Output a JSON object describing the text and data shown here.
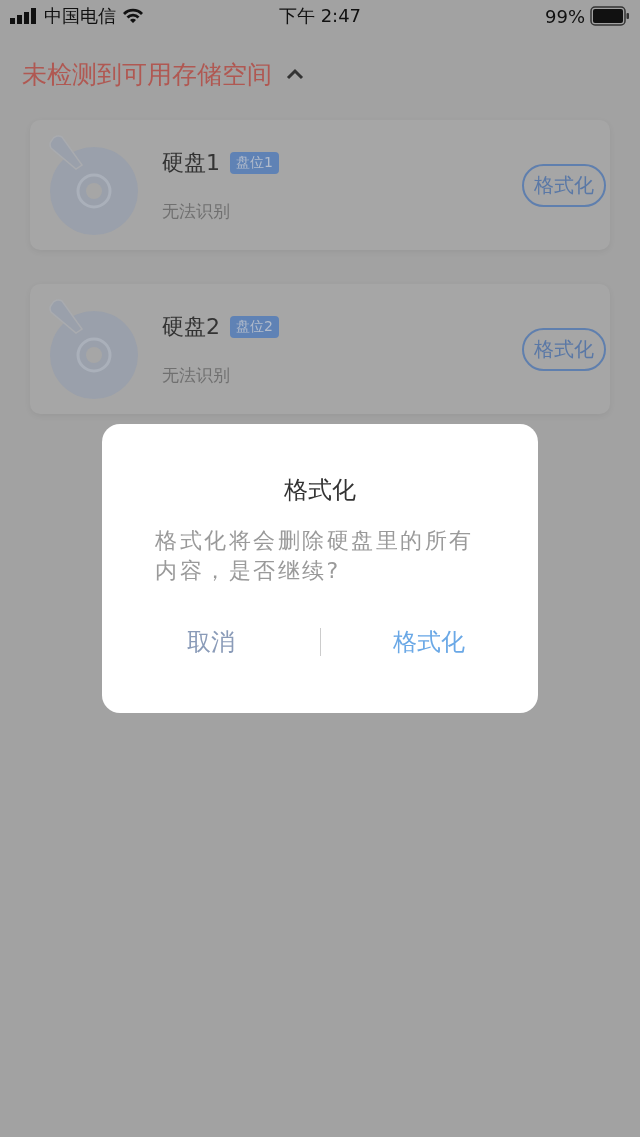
{
  "status_bar": {
    "carrier": "中国电信",
    "time": "下午 2:47",
    "battery": "99%"
  },
  "section": {
    "title": "未检测到可用存储空间",
    "expanded": true
  },
  "disks": [
    {
      "name": "硬盘1",
      "slot": "盘位1",
      "status": "无法识别",
      "action": "格式化"
    },
    {
      "name": "硬盘2",
      "slot": "盘位2",
      "status": "无法识别",
      "action": "格式化"
    }
  ],
  "dialog": {
    "title": "格式化",
    "message": "格式化将会删除硬盘里的所有内容，是否继续?",
    "buttons": [
      {
        "kind": "cancel",
        "label": "取消"
      },
      {
        "kind": "confirm",
        "label": "格式化"
      }
    ]
  }
}
